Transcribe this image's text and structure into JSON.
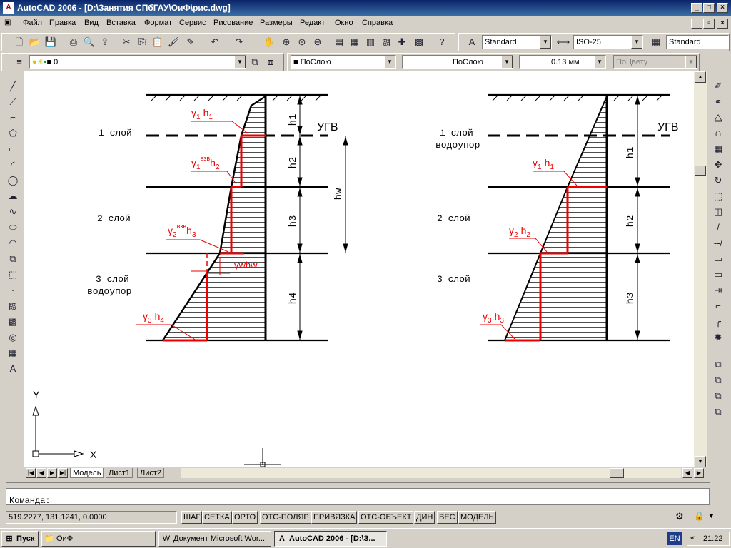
{
  "window": {
    "title": "AutoCAD 2006 - [D:\\Занятия СПбГАУ\\ОиФ\\рис.dwg]"
  },
  "menu": [
    "Файл",
    "Правка",
    "Вид",
    "Вставка",
    "Формат",
    "Сервис",
    "Рисование",
    "Размеры",
    "Редакт",
    "Окно",
    "Справка"
  ],
  "styles": {
    "text_style": "Standard",
    "dim_style": "ISO-25",
    "table_style": "Standard"
  },
  "layers": {
    "current": "0",
    "color": "ПоСлою",
    "linetype": "ПоСлою",
    "lineweight": "0.13 мм",
    "plotstyle": "ПоЦвету"
  },
  "tabs": [
    "Модель",
    "Лист1",
    "Лист2"
  ],
  "command": {
    "prompt": "Команда:"
  },
  "status": {
    "coords": "519.2277, 131.1241, 0.0000",
    "buttons": [
      "ШАГ",
      "СЕТКА",
      "ОРТО",
      "ОТС-ПОЛЯР",
      "ПРИВЯЗКА",
      "ОТС-ОБЪЕКТ",
      "ДИН",
      "ВЕС",
      "МОДЕЛЬ"
    ]
  },
  "taskbar": {
    "start": "Пуск",
    "items": [
      "ОиФ",
      "Документ Microsoft Wor...",
      "AutoCAD 2006 - [D:\\З..."
    ],
    "lang": "EN",
    "clock": "21:22"
  },
  "drawing": {
    "left": {
      "layer1": "1 слой",
      "layer2": "2 слой",
      "layer3": "3 слой",
      "layer3_sub": "водоупор",
      "ugv": "УГВ",
      "h1": "h1",
      "h2": "h2",
      "h3": "h3",
      "h4": "h4",
      "hw": "hw",
      "gamma": "γ",
      "sub1": "1",
      "sub2": "2",
      "sub3": "3",
      "sup": "взв",
      "lbl_h1": "h",
      "lbl_h2": "h",
      "lbl_h3": "h",
      "lbl_h4": "h",
      "n1": "1",
      "n2": "2",
      "n3": "3",
      "n4": "4",
      "gwhw": "γwhw"
    },
    "right": {
      "layer1": "1 слой",
      "layer1_sub": "водоупор",
      "layer2": "2 слой",
      "layer3": "3 слой",
      "ugv": "УГВ",
      "h1": "h1",
      "h2": "h2",
      "h3": "h3",
      "gamma": "γ",
      "sub1": "1",
      "sub2": "2",
      "sub3": "3",
      "lbl_h": "h",
      "n1": "1",
      "n2": "2",
      "n3": "3"
    },
    "ucs": {
      "x": "X",
      "y": "Y"
    }
  }
}
